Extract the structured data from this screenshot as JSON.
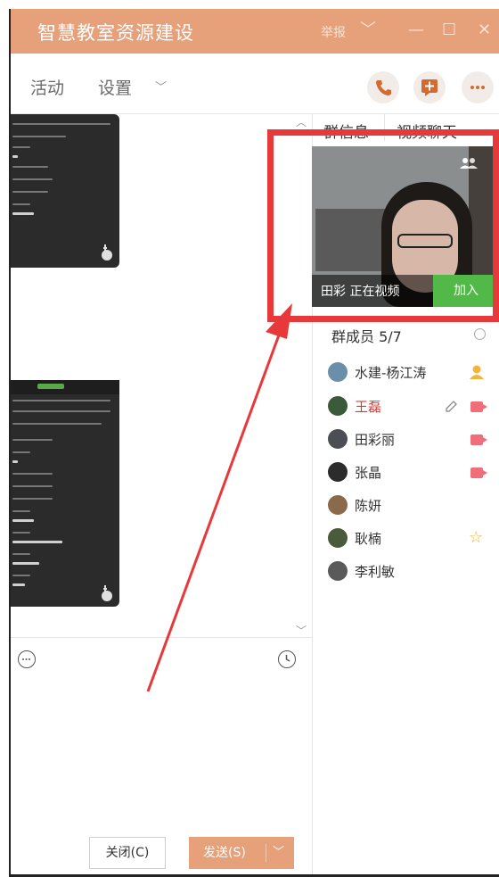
{
  "window": {
    "title": "智慧教室资源建设",
    "report_label": "举报",
    "controls": [
      "﹀",
      "—",
      "☐",
      "✕"
    ]
  },
  "toolbar": {
    "tabs": [
      "活动",
      "设置"
    ],
    "icons": [
      "phone-icon",
      "chat-add-icon",
      "more-icon"
    ]
  },
  "right_panel": {
    "tabs": [
      "群信息",
      "视频聊天"
    ],
    "video_card": {
      "status_label": "田彩 正在视频",
      "join_label": "加入"
    },
    "member_header": "群成员 5/7",
    "members": [
      {
        "name": "水建-杨江涛",
        "avatar_color": "#6b8fa8",
        "highlight": false,
        "badge": "admin-icon"
      },
      {
        "name": "王磊",
        "avatar_color": "#3a5a3a",
        "highlight": true,
        "badge": "video-icon"
      },
      {
        "name": "田彩丽",
        "avatar_color": "#4b4f55",
        "highlight": false,
        "badge": "video-icon"
      },
      {
        "name": "张晶",
        "avatar_color": "#2c2c2c",
        "highlight": false,
        "badge": "video-icon"
      },
      {
        "name": "陈妍",
        "avatar_color": "#8a6a4a",
        "highlight": false,
        "badge": ""
      },
      {
        "name": "耿楠",
        "avatar_color": "#4a5a3a",
        "highlight": false,
        "badge": "star-icon"
      },
      {
        "name": "李利敏",
        "avatar_color": "#5a5a5a",
        "highlight": false,
        "badge": ""
      }
    ]
  },
  "footer": {
    "close_label": "关闭(C)",
    "send_label": "发送(S)",
    "send_arrow": "﹀"
  },
  "colors": {
    "accent": "#e6a07a",
    "highlight_red": "#e8393a",
    "join_green": "#52b848",
    "member_red": "#e0382f"
  }
}
